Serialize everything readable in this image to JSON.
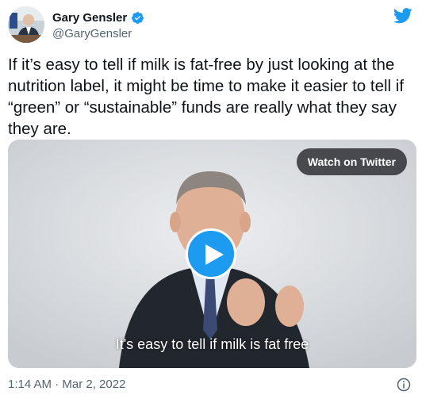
{
  "author": {
    "display_name": "Gary Gensler",
    "handle": "@GaryGensler",
    "verified": true
  },
  "tweet": {
    "text": "If it’s easy to tell if milk is fat-free by just looking at the nutrition label, it might be time to make it easier to tell if “green” or “sustainable” funds are really what they say they are."
  },
  "media": {
    "watch_label": "Watch on Twitter",
    "caption": "It's easy to tell if milk is fat free",
    "play_icon": "play-icon"
  },
  "footer": {
    "timestamp": "1:14 AM · Mar 2, 2022",
    "info_icon": "info-icon"
  },
  "colors": {
    "accent": "#1d9bf0",
    "text": "#0f1419",
    "muted": "#536471"
  }
}
